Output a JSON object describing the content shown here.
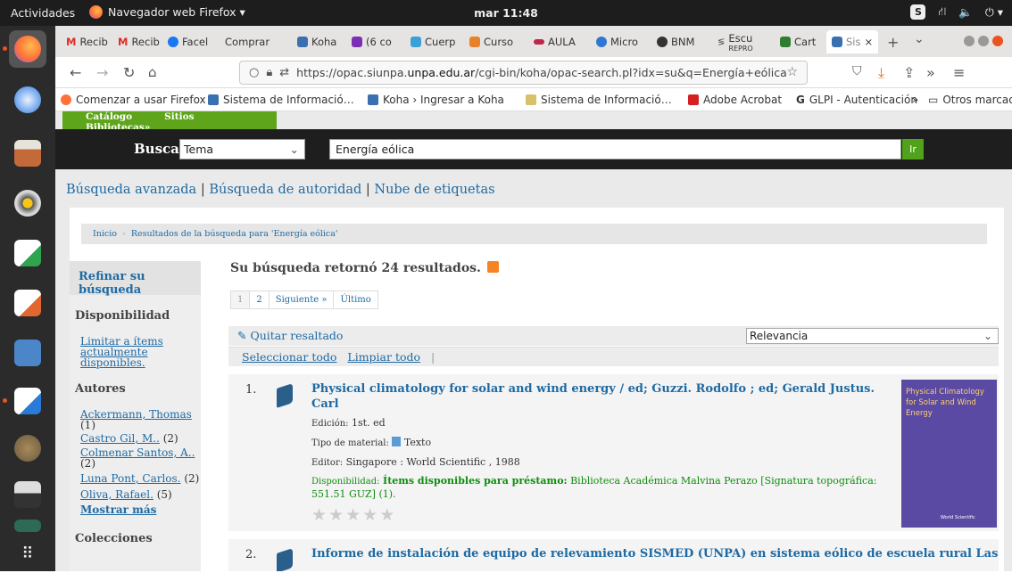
{
  "topbar": {
    "activities": "Actividades",
    "app": "Navegador web Firefox ▾",
    "clock": "mar 11:48",
    "s_badge": "S",
    "tray_icons": "network, volume, power"
  },
  "dock": {
    "items": [
      "firefox",
      "thunderbird",
      "files",
      "rhythmbox",
      "libreoffice-calc",
      "libreoffice-impress",
      "screenshot",
      "libreoffice-writer",
      "gimp",
      "scanner",
      "terminal",
      "apps-grid"
    ]
  },
  "tabs": [
    {
      "label": "Recib",
      "icon": "gmail-icon"
    },
    {
      "label": "Recib",
      "icon": "gmail-icon"
    },
    {
      "label": "Facel",
      "icon": "facebook-icon"
    },
    {
      "label": "Comprar",
      "icon": "none"
    },
    {
      "label": "Koha",
      "icon": "koha-icon"
    },
    {
      "label": "(6 co",
      "icon": "mail-icon"
    },
    {
      "label": "Cuerp",
      "icon": "doc-icon"
    },
    {
      "label": "Curso",
      "icon": "course-icon"
    },
    {
      "label": "AULA",
      "icon": "aula-icon"
    },
    {
      "label": "Micro",
      "icon": "edge-icon"
    },
    {
      "label": "BNM",
      "icon": "bnm-icon"
    },
    {
      "label": "Escu",
      "sub": "REPRO",
      "icon": "escuela-icon"
    },
    {
      "label": "Cart",
      "icon": "cart-icon"
    },
    {
      "label": "Sis",
      "icon": "koha-icon",
      "close": "×"
    }
  ],
  "tabbar": {
    "new_tab": "+",
    "list": "⌄"
  },
  "nav": {
    "url_host_prefix": "https://opac.siunpa.",
    "url_host_bold": "unpa.edu.ar",
    "url_path": "/cgi-bin/koha/opac-search.pl?idx=su&q=Energía+eólica"
  },
  "bookmarks": [
    {
      "label": "Comenzar a usar Firefox",
      "icon": "firefox-icon"
    },
    {
      "label": "Sistema de Informació…",
      "icon": "koha-icon"
    },
    {
      "label": "Koha › Ingresar a Koha",
      "icon": "koha-icon"
    },
    {
      "label": "Sistema de Informació…",
      "icon": "siu-icon"
    },
    {
      "label": "Adobe Acrobat",
      "icon": "acrobat-icon"
    },
    {
      "label": "GLPI - Autenticación",
      "icon": "glpi-icon"
    }
  ],
  "bookmarks_more": "»",
  "bookmarks_other": "Otros marcadores",
  "opac": {
    "tabs": [
      "Catálogo",
      "Sitios Bibliotecas»"
    ],
    "search_label": "Buscar",
    "search_index": "Tema",
    "search_query": "Energía eólica",
    "go": "Ir",
    "links": [
      "Búsqueda avanzada",
      "Búsqueda de autoridad",
      "Nube de etiquetas"
    ],
    "crumbs": [
      "Inicio",
      "Resultados de la búsqueda para 'Energía eólica'"
    ],
    "refine": "Refinar su búsqueda",
    "availability_h": "Disponibilidad",
    "availability_link": "Limitar a ítems actualmente disponibles.",
    "authors_h": "Autores",
    "authors": [
      {
        "name": "Ackermann, Thomas",
        "count": "(1)"
      },
      {
        "name": "Castro Gil, M..",
        "count": "(2)"
      },
      {
        "name": "Colmenar Santos, A..",
        "count": "(2)"
      },
      {
        "name": "Luna Pont, Carlos.",
        "count": "(2)"
      },
      {
        "name": "Oliva, Rafael.",
        "count": "(5)"
      }
    ],
    "more": "Mostrar más",
    "collections_h": "Colecciones",
    "results_title": "Su búsqueda retornó 24 resultados.",
    "pager": [
      "1",
      "2",
      "Siguiente »",
      "Último"
    ],
    "remove_highlight": "Quitar resaltado",
    "sort": "Relevancia",
    "select_all": "Seleccionar todo",
    "clear_all": "Limpiar todo",
    "results": [
      {
        "num": "1.",
        "title": "Physical climatology for solar and wind energy / ed; Guzzi. Rodolfo ; ed; Gerald Justus. Carl",
        "edition_label": "Edición:",
        "edition": "1st. ed",
        "type_label": "Tipo de material:",
        "type": "Texto",
        "publisher_label": "Editor:",
        "publisher": "Singapore : World Scientific , 1988",
        "avail_label": "Disponibilidad:",
        "avail_status": "Ítems disponibles para préstamo:",
        "avail_detail": "Biblioteca Académica Malvina Perazo [Signatura topográfica: 551.51 GUZ] (1).",
        "rating": "0 of 5",
        "cover_title": "Physical Climatology for Solar and Wind Energy",
        "cover_publisher": "World Scientific"
      },
      {
        "num": "2.",
        "title": "Informe de instalación de equipo de relevamiento SISMED (UNPA) en sistema eólico de escuela rural Las"
      }
    ]
  }
}
